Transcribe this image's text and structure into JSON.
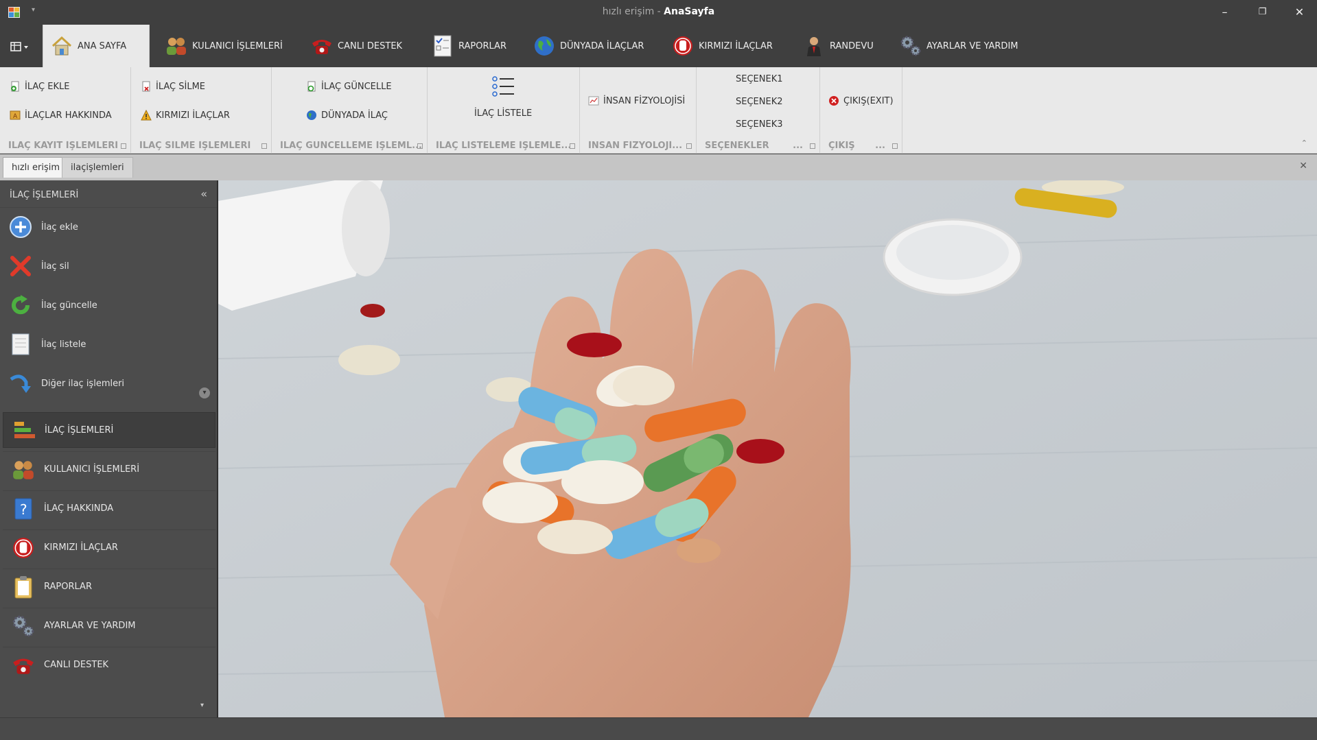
{
  "window": {
    "title_prefix": "hızlı erişim - ",
    "title_main": "AnaSayfa",
    "minimize": "–",
    "restore": "❐",
    "close": "✕"
  },
  "ribbon_tabs": [
    {
      "label": "ANA SAYFA",
      "icon": "home-icon"
    },
    {
      "label": "KULANICI İŞLEMLERİ",
      "icon": "users-icon"
    },
    {
      "label": "CANLI DESTEK",
      "icon": "phone-icon"
    },
    {
      "label": "RAPORLAR",
      "icon": "checklist-icon"
    },
    {
      "label": "DÜNYADA İLAÇLAR",
      "icon": "globe-icon"
    },
    {
      "label": "KIRMIZI İLAÇLAR",
      "icon": "stop-hand-icon"
    },
    {
      "label": "RANDEVU",
      "icon": "person-icon"
    },
    {
      "label": "AYARLAR VE YARDIM",
      "icon": "gears-icon"
    }
  ],
  "ribbon_groups": {
    "kayit": {
      "title": "İLAÇ KAYIT İŞLEMLERİ",
      "btn1": "İLAÇ EKLE",
      "btn2": "İLAÇLAR HAKKINDA"
    },
    "silme": {
      "title": "İLAÇ SİLME İŞLEMLERİ",
      "btn1": "İLAÇ SİLME",
      "btn2": "KIRMIZI İLAÇLAR"
    },
    "guncelleme": {
      "title": "İLAÇ GÜNCELLEME İŞLEML...",
      "btn1": "İLAÇ GÜNCELLE",
      "btn2": "DÜNYADA İLAÇ"
    },
    "listeleme": {
      "title": "İLAÇ LİSTELEME İŞLEMLE...",
      "btn1": "İLAÇ LİSTELE"
    },
    "fizyoloji": {
      "title": "İNSAN FİZYOLOJİ...",
      "btn1": "İNSAN FİZYOLOJİSİ"
    },
    "secenekler": {
      "title": "SEÇENEKLER",
      "more": "...",
      "opt1": "SEÇENEK1",
      "opt2": "SEÇENEK2",
      "opt3": "SEÇENEK3"
    },
    "cikis": {
      "title": "ÇIKIŞ",
      "more": "...",
      "btn1": "ÇIKIŞ(EXIT)"
    }
  },
  "doc_tabs": [
    "hızlı erişim",
    "ilaçişlemleri"
  ],
  "sidenav": {
    "header": "İLAÇ İŞLEMLERİ",
    "items": [
      {
        "label": "İlaç ekle",
        "icon": "add-circle-icon"
      },
      {
        "label": "İlaç sil",
        "icon": "red-x-icon"
      },
      {
        "label": "İlaç güncelle",
        "icon": "refresh-icon"
      },
      {
        "label": "İlaç listele",
        "icon": "document-icon"
      },
      {
        "label": "Diğer ilaç işlemleri",
        "icon": "redo-arrow-icon"
      }
    ],
    "groups": [
      {
        "label": "İLAÇ İŞLEMLERİ",
        "icon": "bars-icon"
      },
      {
        "label": "KULLANICI İŞLEMLERİ",
        "icon": "users-icon"
      },
      {
        "label": "İLAÇ HAKKINDA",
        "icon": "help-book-icon"
      },
      {
        "label": "KIRMIZI İLAÇLAR",
        "icon": "stop-hand-icon"
      },
      {
        "label": "RAPORLAR",
        "icon": "clipboard-icon"
      },
      {
        "label": "AYARLAR VE YARDIM",
        "icon": "gears-icon"
      },
      {
        "label": "CANLI DESTEK",
        "icon": "phone-icon"
      }
    ]
  },
  "colors": {
    "titlebar": "#3f3f3f",
    "ribbon": "#e9e9e9",
    "sidenav": "#4c4c4c"
  }
}
